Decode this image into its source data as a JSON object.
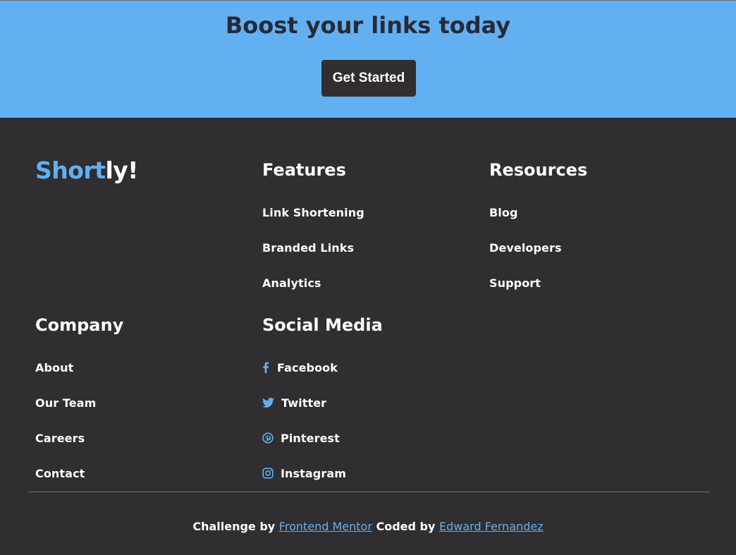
{
  "cta_banner": {
    "title": "Boost your links today",
    "button_label": "Get Started"
  },
  "brand": {
    "logo_part1": "Short",
    "logo_part2": "ly!"
  },
  "features": {
    "heading": "Features",
    "links": [
      "Link Shortening",
      "Branded Links",
      "Analytics"
    ]
  },
  "resources": {
    "heading": "Resources",
    "links": [
      "Blog",
      "Developers",
      "Support"
    ]
  },
  "company": {
    "heading": "Company",
    "links": [
      "About",
      "Our Team",
      "Careers",
      "Contact"
    ]
  },
  "social": {
    "heading": "Social Media",
    "links": [
      {
        "label": "Facebook",
        "icon": "facebook-icon"
      },
      {
        "label": "Twitter",
        "icon": "twitter-icon"
      },
      {
        "label": "Pinterest",
        "icon": "pinterest-icon"
      },
      {
        "label": "Instagram",
        "icon": "instagram-icon"
      }
    ]
  },
  "credits": {
    "prefix": "Challenge by ",
    "link1": "Frontend Mentor",
    "middle": " Coded by ",
    "link2": "Edward Fernandez"
  },
  "colors": {
    "accent": "#62b0f2",
    "dark": "#302e30",
    "title_text": "#262a36"
  }
}
